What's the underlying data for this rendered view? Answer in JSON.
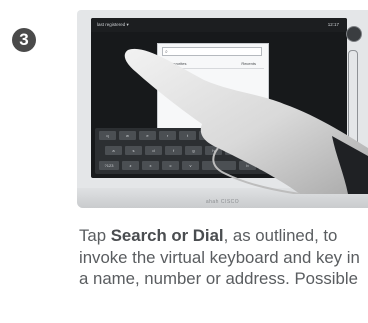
{
  "step": {
    "number": "3"
  },
  "device": {
    "status_left": "last registered ▾",
    "status_right": "12:17",
    "search_placeholder": "",
    "tabs": [
      "Favorites",
      "Recents"
    ],
    "directory_note": "No directory",
    "brand": "ahah CISCO",
    "keyboard_rows": [
      [
        "q",
        "w",
        "e",
        "r",
        "t",
        "y",
        "u",
        "i",
        "o",
        "p"
      ],
      [
        "a",
        "s",
        "d",
        "f",
        "g",
        "h",
        "j",
        "k",
        "l"
      ],
      [
        "?123",
        "z",
        "x",
        "c",
        "v",
        "",
        "b",
        "n",
        "m"
      ]
    ]
  },
  "instruction": {
    "pre": "Tap ",
    "bold": "Search or Dial",
    "post": ", as outlined, to invoke the virtual keyboard and key in a name, number or address. Possible"
  }
}
